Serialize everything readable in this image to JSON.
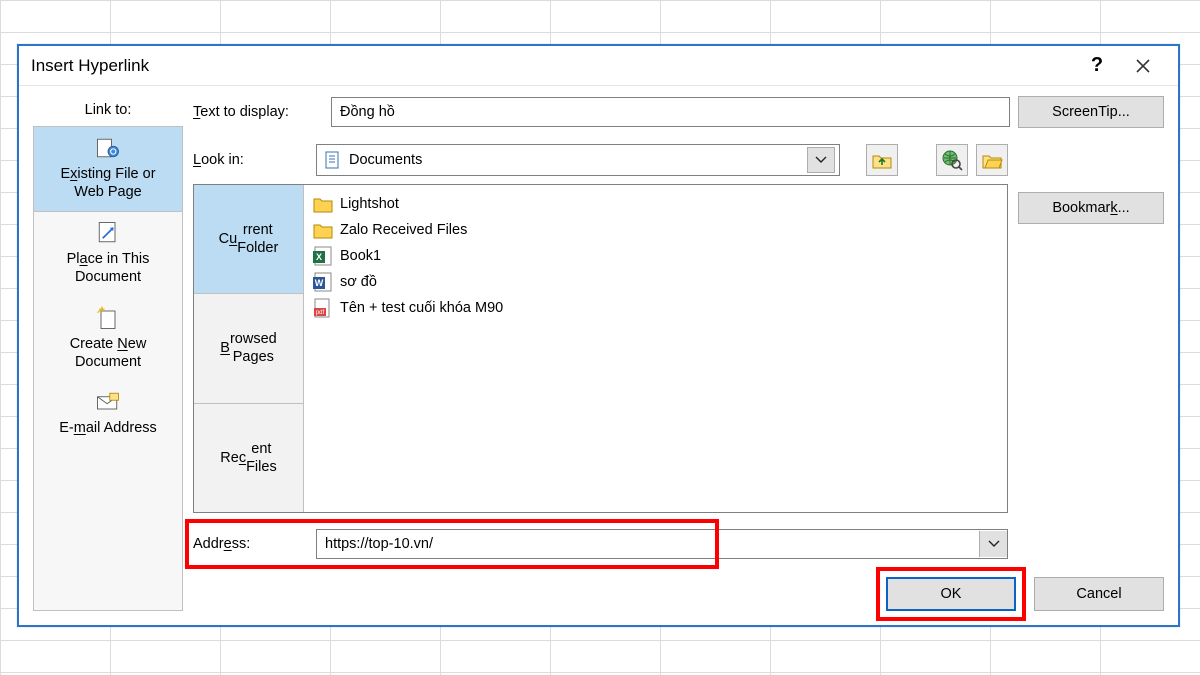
{
  "dialog": {
    "title": "Insert Hyperlink",
    "help_icon": "?",
    "close_icon": "✕"
  },
  "linkto": {
    "header": "Link to:",
    "items": [
      {
        "label_html": "Existing File or\nWeb Page"
      },
      {
        "label_html": "Place in This\nDocument"
      },
      {
        "label_html": "Create New\nDocument"
      },
      {
        "label_html": "E-mail Address"
      }
    ]
  },
  "text_to_display": {
    "label": "Text to display:",
    "value": "Đồng hồ"
  },
  "screentip_btn": "ScreenTip...",
  "bookmark_btn": "Bookmark...",
  "lookin": {
    "label": "Look in:",
    "value": "Documents"
  },
  "nav_tabs": [
    {
      "label": "Current\nFolder"
    },
    {
      "label": "Browsed\nPages"
    },
    {
      "label": "Recent\nFiles"
    }
  ],
  "files": [
    {
      "name": "Lightshot",
      "type": "folder"
    },
    {
      "name": "Zalo Received Files",
      "type": "folder"
    },
    {
      "name": "Book1",
      "type": "excel"
    },
    {
      "name": "sơ đồ",
      "type": "word"
    },
    {
      "name": "Tên + test cuối khóa M90",
      "type": "pdf"
    }
  ],
  "address": {
    "label": "Address:",
    "value": "https://top-10.vn/"
  },
  "buttons": {
    "ok": "OK",
    "cancel": "Cancel"
  }
}
